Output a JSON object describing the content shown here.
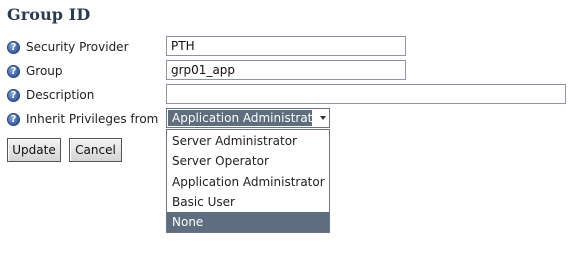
{
  "page_title": "Group ID",
  "fields": {
    "security_provider": {
      "label": "Security Provider",
      "value": "PTH"
    },
    "group": {
      "label": "Group",
      "value": "grp01_app"
    },
    "description": {
      "label": "Description",
      "value": ""
    },
    "inherit": {
      "label": "Inherit Privileges from",
      "value": "Application Administrator"
    }
  },
  "dropdown_options": [
    {
      "label": "Server Administrator",
      "highlighted": false
    },
    {
      "label": "Server Operator",
      "highlighted": false
    },
    {
      "label": "Application Administrator",
      "highlighted": false
    },
    {
      "label": "Basic User",
      "highlighted": false
    },
    {
      "label": "None",
      "highlighted": true
    }
  ],
  "buttons": {
    "update": "Update",
    "cancel": "Cancel"
  },
  "colors": {
    "title": "#2b3a55",
    "selection": "#5e6d80",
    "help_icon": "#3f67a8"
  },
  "icons": {
    "help": "help-question-icon",
    "dropdown": "chevron-down-icon"
  }
}
